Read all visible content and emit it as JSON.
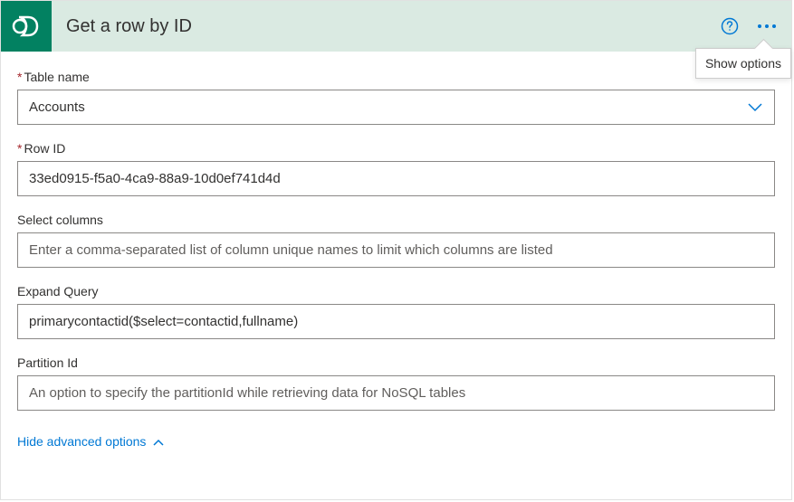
{
  "header": {
    "title": "Get a row by ID",
    "tooltip": "Show options"
  },
  "fields": {
    "tableName": {
      "label": "Table name",
      "value": "Accounts",
      "required": true
    },
    "rowId": {
      "label": "Row ID",
      "value": "33ed0915-f5a0-4ca9-88a9-10d0ef741d4d",
      "required": true
    },
    "selectColumns": {
      "label": "Select columns",
      "placeholder": "Enter a comma-separated list of column unique names to limit which columns are listed",
      "value": ""
    },
    "expandQuery": {
      "label": "Expand Query",
      "value": "primarycontactid($select=contactid,fullname)"
    },
    "partitionId": {
      "label": "Partition Id",
      "placeholder": "An option to specify the partitionId while retrieving data for NoSQL tables",
      "value": ""
    }
  },
  "advancedToggle": "Hide advanced options"
}
